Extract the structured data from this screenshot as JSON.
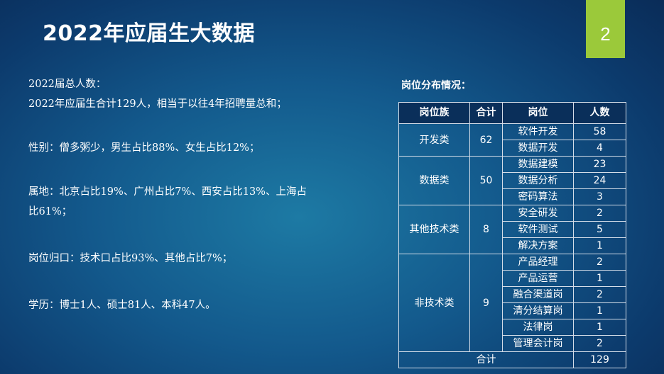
{
  "slide": {
    "title": "2022年应届生大数据",
    "page_number": "2"
  },
  "summary": {
    "total_label": "2022届总人数：",
    "total_text": "2022年应届生合计129人，相当于以往4年招聘量总和；",
    "gender": "性别：僧多粥少，男生占比88%、女生占比12%；",
    "location_line1": "属地：北京占比19%、广州占比7%、西安占比13%、上海占",
    "location_line2": "比61%；",
    "position": "岗位归口：技术口占比93%、其他占比7%；",
    "education": "学历：博士1人、硕士81人、本科47人。"
  },
  "table": {
    "title": "岗位分布情况：",
    "headers": [
      "岗位族",
      "合计",
      "岗位",
      "人数"
    ],
    "groups": [
      {
        "family": "开发类",
        "total": "62",
        "rows": [
          {
            "position": "软件开发",
            "count": "58"
          },
          {
            "position": "数据开发",
            "count": "4"
          }
        ]
      },
      {
        "family": "数据类",
        "total": "50",
        "rows": [
          {
            "position": "数据建模",
            "count": "23"
          },
          {
            "position": "数据分析",
            "count": "24"
          },
          {
            "position": "密码算法",
            "count": "3"
          }
        ]
      },
      {
        "family": "其他技术类",
        "total": "8",
        "rows": [
          {
            "position": "安全研发",
            "count": "2"
          },
          {
            "position": "软件测试",
            "count": "5"
          },
          {
            "position": "解决方案",
            "count": "1"
          }
        ]
      },
      {
        "family": "非技术类",
        "total": "9",
        "rows": [
          {
            "position": "产品经理",
            "count": "2"
          },
          {
            "position": "产品运营",
            "count": "1"
          },
          {
            "position": "融合渠道岗",
            "count": "2"
          },
          {
            "position": "清分结算岗",
            "count": "1"
          },
          {
            "position": "法律岗",
            "count": "1"
          },
          {
            "position": "管理会计岗",
            "count": "2"
          }
        ]
      }
    ],
    "total_label": "合计",
    "total_value": "129"
  },
  "colors": {
    "accent": "#9bc93a",
    "header_bg": "#0a2f5a",
    "background": "#13598c"
  }
}
